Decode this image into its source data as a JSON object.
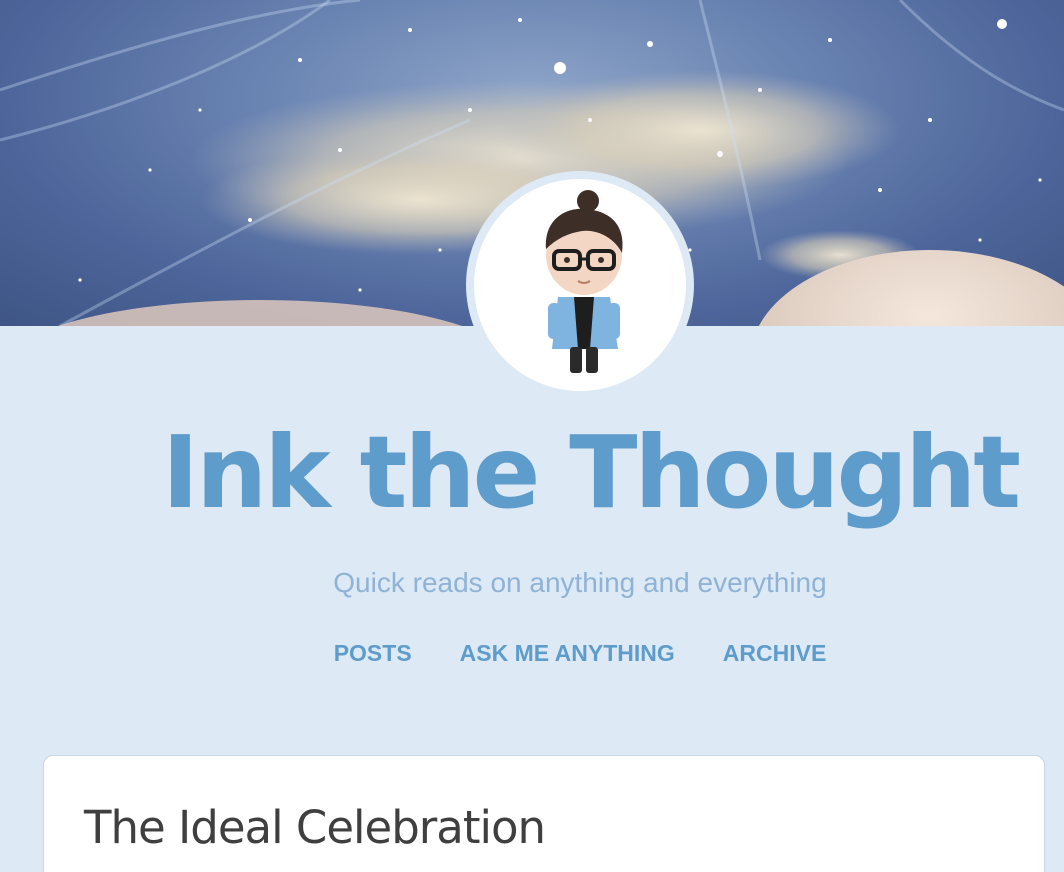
{
  "blog": {
    "title": "Ink the Thought",
    "tagline": "Quick reads on anything and everything"
  },
  "nav": {
    "items": [
      {
        "label": "POSTS"
      },
      {
        "label": "ASK ME ANYTHING"
      },
      {
        "label": "ARCHIVE"
      }
    ]
  },
  "post": {
    "title": "The Ideal Celebration"
  },
  "colors": {
    "accent": "#5e9ccb",
    "background": "#dde9f4",
    "tagline": "#8fb3d6",
    "post_title": "#3f3f3f"
  },
  "icons": {
    "header": "starry-sky-header-image",
    "avatar": "cartoon-avatar-image"
  }
}
